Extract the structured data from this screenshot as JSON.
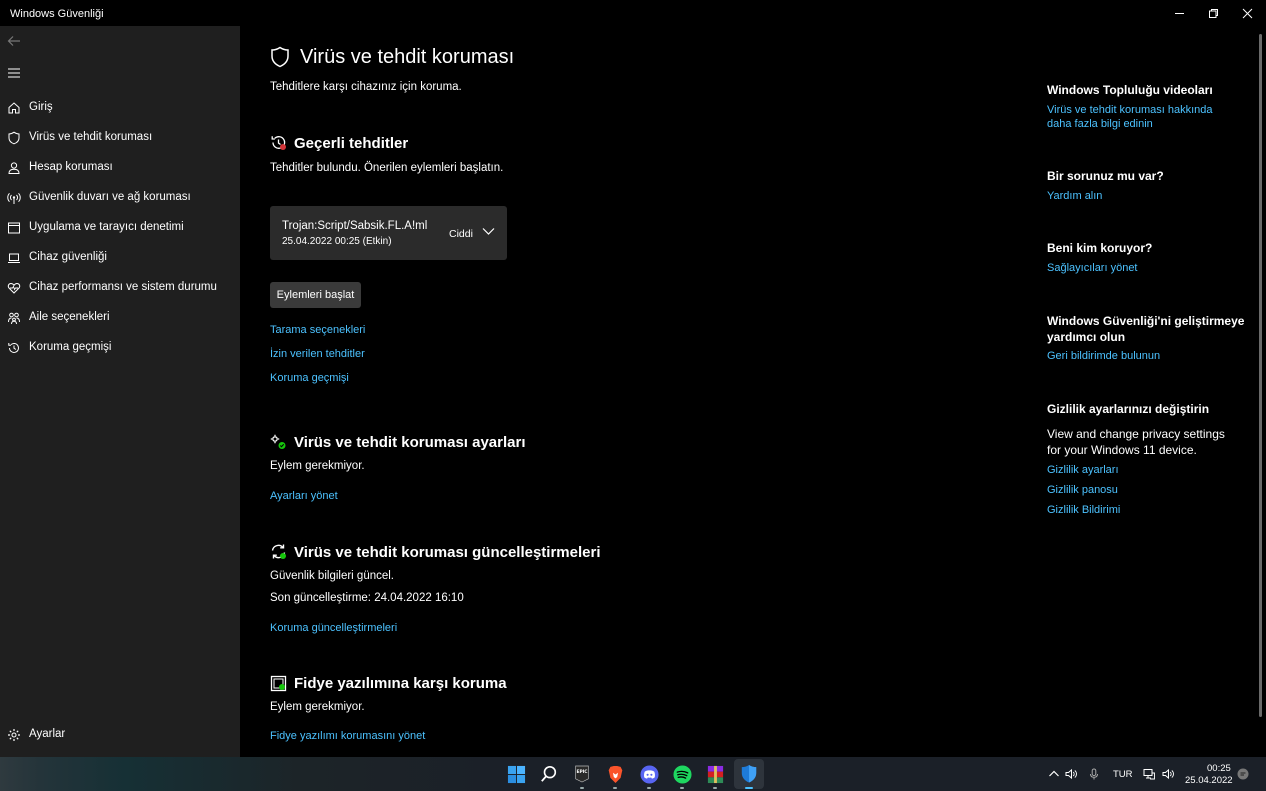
{
  "window": {
    "title": "Windows Güvenliği"
  },
  "sidebar": {
    "items": [
      {
        "label": "Giriş",
        "icon": "home-icon"
      },
      {
        "label": "Virüs ve tehdit koruması",
        "icon": "shield-icon"
      },
      {
        "label": "Hesap koruması",
        "icon": "person-icon"
      },
      {
        "label": "Güvenlik duvarı ve ağ koruması",
        "icon": "antenna-icon"
      },
      {
        "label": "Uygulama ve tarayıcı denetimi",
        "icon": "app-browser-icon"
      },
      {
        "label": "Cihaz güvenliği",
        "icon": "laptop-icon"
      },
      {
        "label": "Cihaz performansı ve sistem durumu",
        "icon": "heart-icon"
      },
      {
        "label": "Aile seçenekleri",
        "icon": "family-icon"
      },
      {
        "label": "Koruma geçmişi",
        "icon": "history-icon"
      }
    ],
    "settings_label": "Ayarlar"
  },
  "main": {
    "title": "Virüs ve tehdit koruması",
    "subtitle": "Tehditlere karşı cihazınız için koruma.",
    "current_threats": {
      "heading": "Geçerli tehditler",
      "description": "Tehditler bulundu. Önerilen eylemleri başlatın.",
      "threat": {
        "name": "Trojan:Script/Sabsik.FL.A!ml",
        "date": "25.04.2022 00:25 (Etkin)",
        "severity": "Ciddi"
      },
      "action_button": "Eylemleri başlat",
      "links": [
        "Tarama seçenekleri",
        "İzin verilen tehditler",
        "Koruma geçmişi"
      ]
    },
    "settings_section": {
      "heading": "Virüs ve tehdit koruması ayarları",
      "status": "Eylem gerekmiyor.",
      "link": "Ayarları yönet"
    },
    "updates_section": {
      "heading": "Virüs ve tehdit koruması güncelleştirmeleri",
      "status": "Güvenlik bilgileri güncel.",
      "last_update": "Son güncelleştirme: 24.04.2022 16:10",
      "link": "Koruma güncelleştirmeleri"
    },
    "ransomware_section": {
      "heading": "Fidye yazılımına karşı koruma",
      "status": "Eylem gerekmiyor.",
      "link": "Fidye yazılımı korumasını yönet"
    }
  },
  "right": {
    "community": {
      "heading": "Windows Topluluğu videoları",
      "link_line1": "Virüs ve tehdit koruması hakkında",
      "link_line2": "daha fazla bilgi edinin"
    },
    "question": {
      "heading": "Bir sorunuz mu var?",
      "link": "Yardım alın"
    },
    "protector": {
      "heading": "Beni kim koruyor?",
      "link": "Sağlayıcıları yönet"
    },
    "improve": {
      "heading_line1": "Windows Güvenliği'ni geliştirmeye",
      "heading_line2": "yardımcı olun",
      "link": "Geri bildirimde bulunun"
    },
    "privacy": {
      "heading": "Gizlilik ayarlarınızı değiştirin",
      "text_line1": "View and change privacy settings",
      "text_line2": "for your Windows 11 device.",
      "links": [
        "Gizlilik ayarları",
        "Gizlilik panosu",
        "Gizlilik Bildirimi"
      ]
    }
  },
  "taskbar": {
    "apps": [
      "start-icon",
      "search-icon",
      "epic-games-icon",
      "brave-icon",
      "discord-icon",
      "spotify-icon",
      "winrar-icon",
      "windows-security-icon"
    ],
    "language": "TUR",
    "time": "00:25",
    "date": "25.04.2022"
  },
  "colors": {
    "accent_link": "#4cc2ff",
    "sidebar_bg": "#1f1f1f",
    "main_bg": "#000000",
    "card_bg": "#2b2b2b"
  }
}
